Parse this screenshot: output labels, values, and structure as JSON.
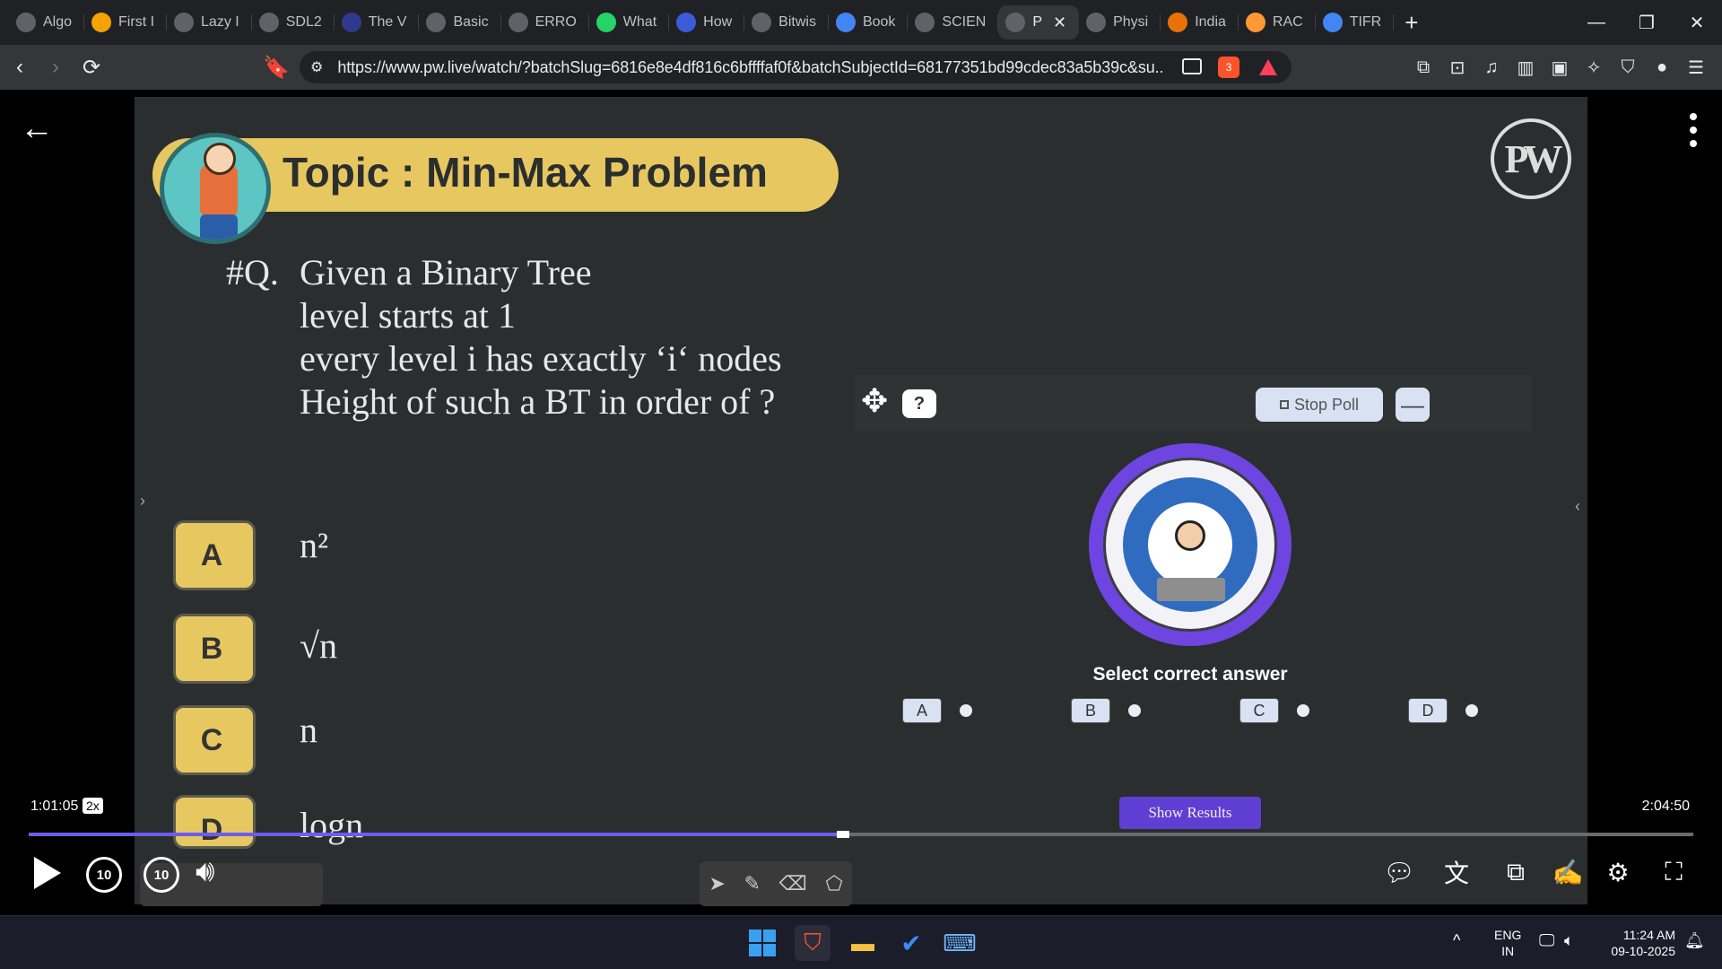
{
  "browser": {
    "tabs": [
      {
        "label": "Algo",
        "color": "#5f6368"
      },
      {
        "label": "First I",
        "color": "#f4a300"
      },
      {
        "label": "Lazy I",
        "color": "#5f6368"
      },
      {
        "label": "SDL2",
        "color": "#5f6368"
      },
      {
        "label": "The V",
        "color": "#2f3a8f"
      },
      {
        "label": "Basic",
        "color": "#5f6368"
      },
      {
        "label": "ERRO",
        "color": "#5f6368"
      },
      {
        "label": "What",
        "color": "#25d366"
      },
      {
        "label": "How",
        "color": "#3b5bdb"
      },
      {
        "label": "Bitwis",
        "color": "#5f6368"
      },
      {
        "label": "Book",
        "color": "#4285f4"
      },
      {
        "label": "SCIEN",
        "color": "#5f6368"
      },
      {
        "label": "P",
        "color": "#5f6368",
        "active": true
      },
      {
        "label": "Physi",
        "color": "#5f6368"
      },
      {
        "label": "India",
        "color": "#e8710a"
      },
      {
        "label": "RAC",
        "color": "#ff9933"
      },
      {
        "label": "TIFR",
        "color": "#4285f4"
      }
    ],
    "active_tab_close": "✕",
    "url": "https://www.pw.live/watch/?batchSlug=6816e8e4df816c6bffffaf0f&batchSubjectId=68177351bd99cdec83a5b39c&su...",
    "brave_badge": "3"
  },
  "slide": {
    "topic": "Topic : Min-Max Problem",
    "logo_text": "PW",
    "question_number": "#Q.",
    "question_lines": [
      "Given a Binary Tree",
      "level starts at 1",
      "every level i has exactly ‘i‘ nodes",
      "Height of such a BT  in order of ?"
    ],
    "options": [
      {
        "letter": "A",
        "text": "n²"
      },
      {
        "letter": "B",
        "text": "√n"
      },
      {
        "letter": "C",
        "text": "n"
      },
      {
        "letter": "D",
        "text": "logn"
      }
    ]
  },
  "poll": {
    "help": "?",
    "stop_label": "Stop Poll",
    "minimize": "—",
    "prompt": "Select correct answer",
    "choices": [
      "A",
      "B",
      "C",
      "D"
    ],
    "show_results": "Show Results"
  },
  "player": {
    "current_time": "1:01:05",
    "speed": "2x",
    "total_time": "2:04:50",
    "progress_percent": 48.9,
    "skip_back": "10",
    "skip_forward": "10"
  },
  "taskbar": {
    "lang_top": "ENG",
    "lang_bottom": "IN",
    "time": "11:24 AM",
    "date": "09-10-2025"
  }
}
